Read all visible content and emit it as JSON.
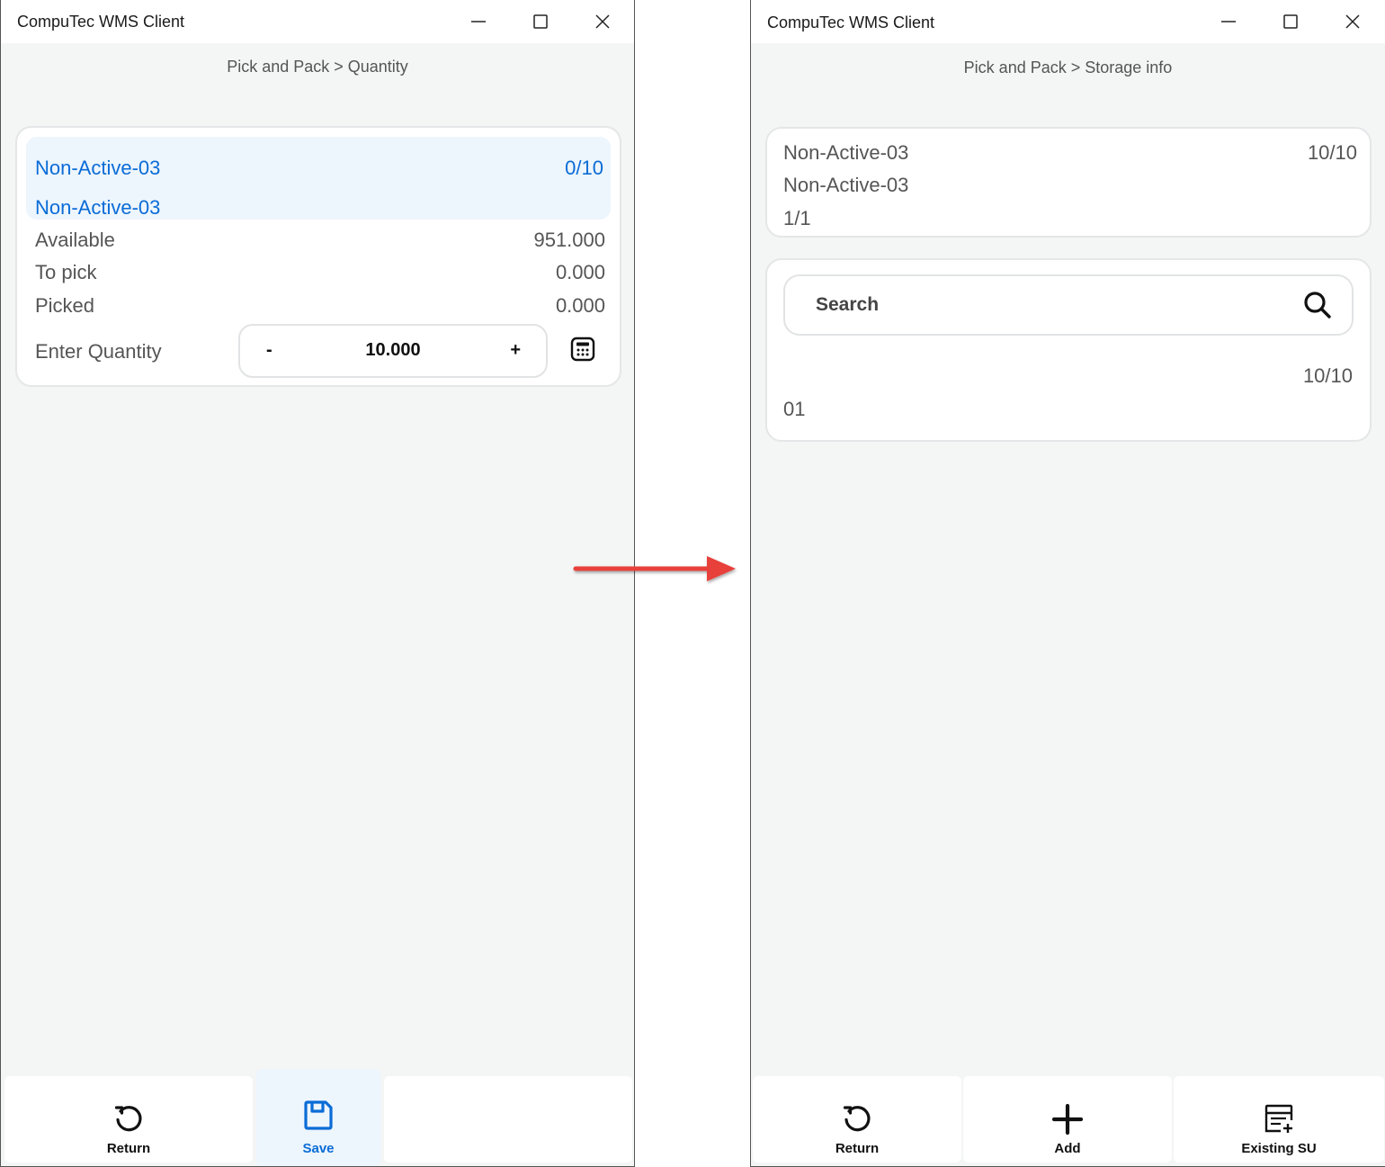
{
  "left": {
    "window_title": "CompuTec WMS Client",
    "breadcrumb": "Pick and Pack > Quantity",
    "item": {
      "code": "Non-Active-03",
      "counter": "0/10",
      "name": "Non-Active-03"
    },
    "available_label": "Available",
    "available_value": "951.000",
    "to_pick_label": "To pick",
    "to_pick_value": "0.000",
    "picked_label": "Picked",
    "picked_value": "0.000",
    "enter_quantity_label": "Enter Quantity",
    "stepper": {
      "minus": "-",
      "value": "10.000",
      "plus": "+"
    },
    "buttons": {
      "return": "Return",
      "save": "Save"
    }
  },
  "right": {
    "window_title": "CompuTec WMS Client",
    "breadcrumb": "Pick and Pack > Storage info",
    "item": {
      "code": "Non-Active-03",
      "counter": "10/10",
      "name": "Non-Active-03",
      "page": "1/1"
    },
    "search_placeholder": "Search",
    "storage": {
      "counter": "10/10",
      "id": "01"
    },
    "buttons": {
      "return": "Return",
      "add": "Add",
      "existing_su": "Existing SU"
    }
  },
  "colors": {
    "accent": "#0a6cd6",
    "highlight": "#edf5fd",
    "arrow": "#e8413b"
  }
}
